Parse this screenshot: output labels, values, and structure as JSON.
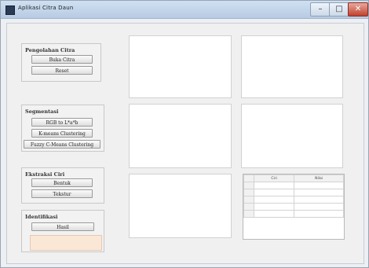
{
  "window": {
    "title": "Aplikasi Citra Daun",
    "controls": {
      "minimize": "–",
      "maximize": "□",
      "close": "✕"
    }
  },
  "panels": {
    "pengolahan": {
      "title": "Pengolahan Citra",
      "buttons": [
        "Buka Citra",
        "Reset"
      ]
    },
    "segmentasi": {
      "title": "Segmentasi",
      "buttons": [
        "RGB to L*a*b",
        "K-means Clustering",
        "Fuzzy C-Means Clustering"
      ]
    },
    "ekstraksi": {
      "title": "Ekstraksi Ciri",
      "buttons": [
        "Bentuk",
        "Tekstur"
      ]
    },
    "identifikasi": {
      "title": "Identifikasi",
      "buttons": [
        "Hasil"
      ],
      "result_value": ""
    }
  },
  "table": {
    "columns": [
      "Ciri",
      "Nilai"
    ],
    "rows": [
      [
        "",
        "",
        ""
      ],
      [
        "",
        "",
        ""
      ],
      [
        "",
        "",
        ""
      ],
      [
        "",
        "",
        ""
      ],
      [
        "",
        "",
        ""
      ]
    ]
  }
}
